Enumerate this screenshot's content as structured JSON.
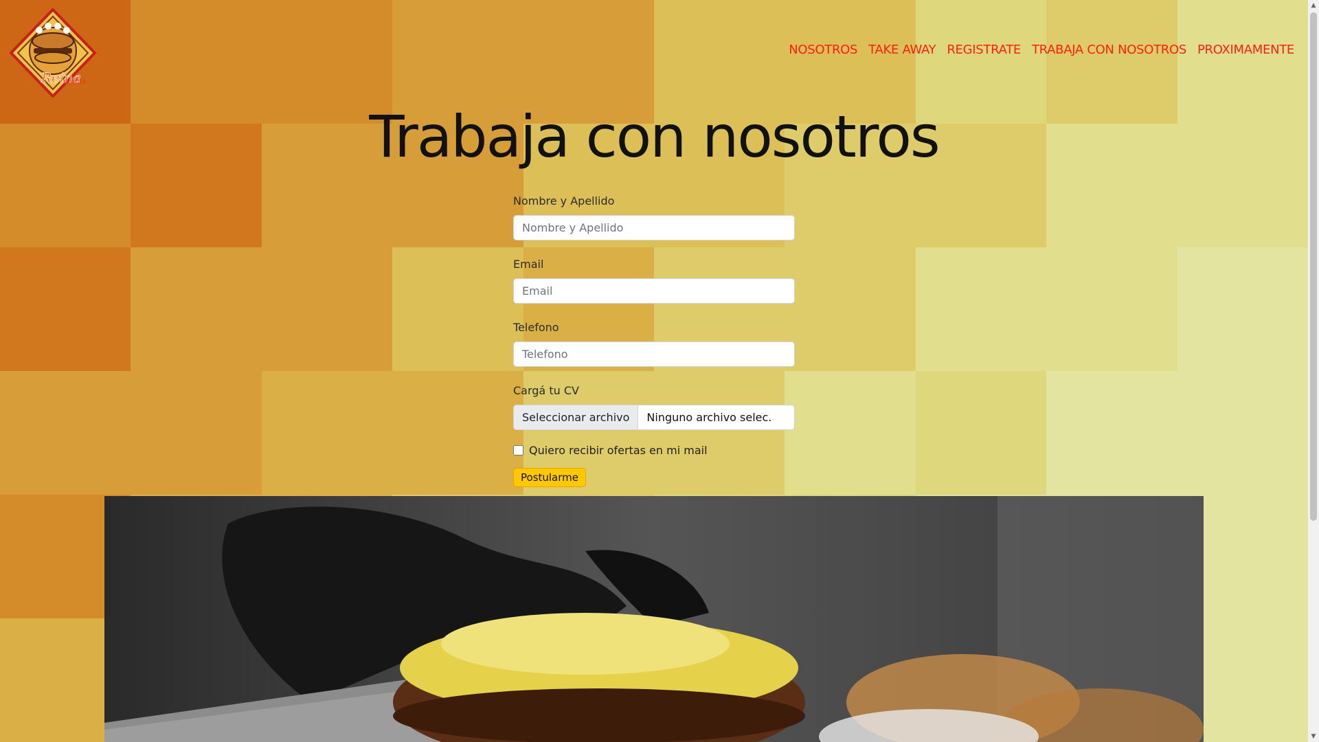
{
  "colors": {
    "nav_link": "#ff1e12",
    "button_bg": "#ffc800",
    "bg_palette": [
      "#cd6615",
      "#d1781f",
      "#d48b2a",
      "#d79d38",
      "#daaf46",
      "#dcbf57",
      "#ddcc69",
      "#dfd77c",
      "#e1df8e",
      "#e3e49f"
    ]
  },
  "brand": {
    "logo_text": "Reina",
    "logo_sub": "BURGER"
  },
  "nav": [
    {
      "label": "NOSOTROS"
    },
    {
      "label": "TAKE AWAY"
    },
    {
      "label": "REGISTRATE"
    },
    {
      "label": "TRABAJA CON NOSOTROS"
    },
    {
      "label": "PROXIMAMENTE"
    }
  ],
  "page_title": "Trabaja con nosotros",
  "form": {
    "name_label": "Nombre y Apellido",
    "name_placeholder": "Nombre y Apellido",
    "email_label": "Email",
    "email_placeholder": "Email",
    "phone_label": "Telefono",
    "phone_placeholder": "Telefono",
    "cv_label": "Cargá tu CV",
    "cv_button": "Seleccionar archivo",
    "cv_filename": "Ninguno archivo selec.",
    "offers_label": "Quiero recibir ofertas en mi mail",
    "submit_label": "Postularme"
  }
}
